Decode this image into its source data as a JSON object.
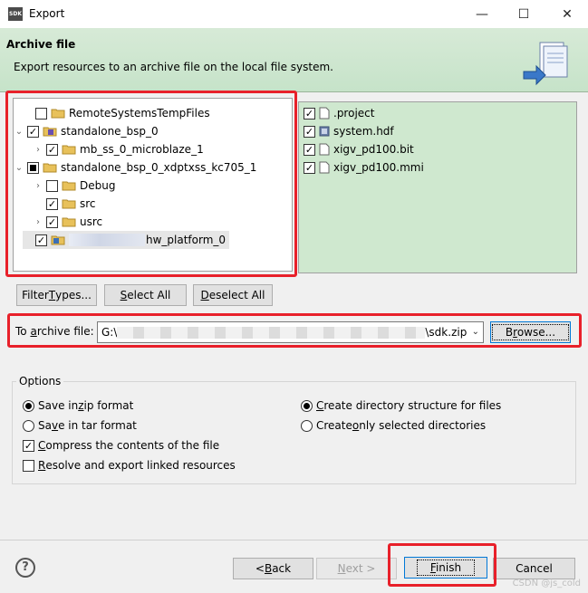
{
  "window": {
    "title": "Export",
    "icon_label": "SDK",
    "controls": {
      "minimize": "—",
      "maximize": "☐",
      "close": "✕"
    }
  },
  "banner": {
    "title": "Archive file",
    "description": "Export resources to an archive file on the local file system."
  },
  "tree": [
    {
      "label": "RemoteSystemsTempFiles",
      "checked": "unchecked",
      "expandable": false,
      "icon": "folder-open-icon"
    },
    {
      "label": "standalone_bsp_0",
      "checked": "checked",
      "expanded": true,
      "icon": "bsp-project-icon"
    },
    {
      "label": "mb_ss_0_microblaze_1",
      "checked": "checked",
      "expandable": true,
      "icon": "folder-icon"
    },
    {
      "label": "standalone_bsp_0_xdptxss_kc705_1",
      "checked": "partial",
      "expanded": true,
      "icon": "folder-icon"
    },
    {
      "label": "Debug",
      "checked": "unchecked",
      "expandable": true,
      "icon": "folder-icon"
    },
    {
      "label": "src",
      "checked": "checked",
      "expandable": false,
      "icon": "folder-icon"
    },
    {
      "label": "usrc",
      "checked": "checked",
      "expandable": true,
      "icon": "folder-icon"
    },
    {
      "label": "hw_platform_0",
      "checked": "checked",
      "expandable": false,
      "icon": "hw-project-icon",
      "redacted_prefix": true
    }
  ],
  "files": [
    {
      "label": ".project",
      "checked": "checked"
    },
    {
      "label": "system.hdf",
      "checked": "checked"
    },
    {
      "label": "xigv_pd100.bit",
      "checked": "checked"
    },
    {
      "label": "xigv_pd100.mmi",
      "checked": "checked"
    }
  ],
  "buttons": {
    "filter_types_pre": "Filter ",
    "filter_types_key": "T",
    "filter_types_post": "ypes...",
    "select_all_key": "S",
    "select_all_post": "elect All",
    "deselect_all_key": "D",
    "deselect_all_post": "eselect All",
    "browse_pre": "B",
    "browse_key": "r",
    "browse_post": "owse...",
    "back_pre": "< ",
    "back_key": "B",
    "back_post": "ack",
    "next_key": "N",
    "next_post": "ext >",
    "finish_key": "F",
    "finish_post": "inish",
    "cancel": "Cancel"
  },
  "archive": {
    "label_pre": "To ",
    "label_key": "a",
    "label_post": "rchive file:",
    "path_start": "G:\\",
    "path_end": "\\sdk.zip"
  },
  "options": {
    "legend": "Options",
    "save_zip": {
      "pre": "Save in ",
      "key": "z",
      "post": "ip format",
      "selected": true
    },
    "save_tar": {
      "pre": "Sa",
      "key": "v",
      "post": "e in tar format",
      "selected": false
    },
    "compress": {
      "pre": "",
      "key": "C",
      "post": "ompress the contents of the file",
      "checked": true
    },
    "resolve": {
      "pre": "",
      "key": "R",
      "post": "esolve and export linked resources",
      "checked": false
    },
    "create_dir": {
      "pre": "",
      "key": "C",
      "post": "reate directory structure for files",
      "selected": true
    },
    "create_sel": {
      "pre": "Create ",
      "key": "o",
      "post": "nly selected directories",
      "selected": false
    }
  },
  "help_label": "?",
  "watermark": "CSDN @js_cold",
  "colors": {
    "banner": "#c6e3c9",
    "file_panel": "#cfe8cf",
    "highlight": "#e8202a",
    "default_button_border": "#0078d7"
  }
}
